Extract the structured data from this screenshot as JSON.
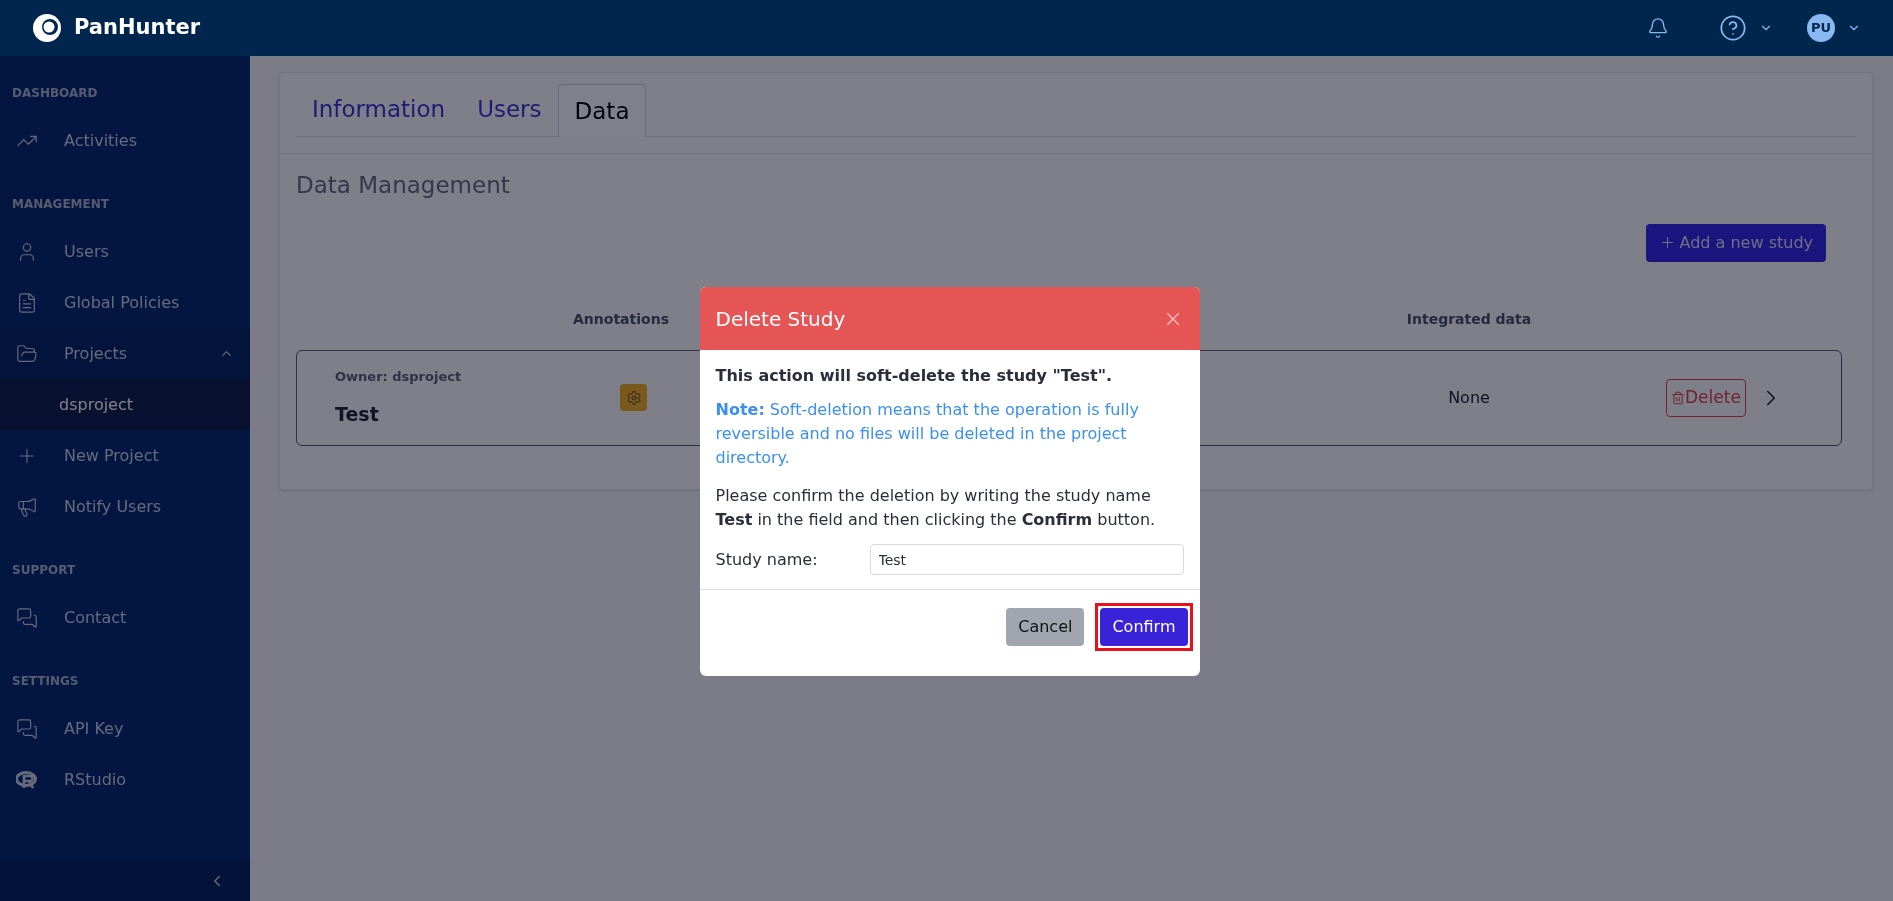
{
  "app": {
    "name": "PanHunter"
  },
  "header": {
    "avatar": "PU"
  },
  "sidebar": {
    "sections": [
      {
        "title": "DASHBOARD",
        "items": [
          {
            "label": "Activities",
            "selected": false
          }
        ]
      },
      {
        "title": "MANAGEMENT",
        "items": [
          {
            "label": "Users",
            "selected": false
          },
          {
            "label": "Global Policies",
            "selected": false
          },
          {
            "label": "Projects",
            "expanded": true,
            "selected": false,
            "children": [
              {
                "label": "dsproject",
                "selected": true
              }
            ]
          },
          {
            "label": "New Project",
            "selected": false
          },
          {
            "label": "Notify Users",
            "selected": false
          }
        ]
      },
      {
        "title": "SUPPORT",
        "items": [
          {
            "label": "Contact",
            "selected": false
          }
        ]
      },
      {
        "title": "SETTINGS",
        "items": [
          {
            "label": "API Key",
            "selected": false
          },
          {
            "label": "RStudio",
            "selected": false
          }
        ]
      }
    ]
  },
  "tabs": [
    {
      "label": "Information",
      "selected": false
    },
    {
      "label": "Users",
      "selected": false
    },
    {
      "label": "Data",
      "selected": true
    }
  ],
  "section_title": "Data Management",
  "add_button": "Add a new study",
  "table": {
    "columns": [
      "Annotations",
      "Integrated data"
    ],
    "rows": [
      {
        "owner": "Owner: dsproject",
        "name": "Test",
        "integrated_data": "None",
        "delete": "Delete"
      }
    ]
  },
  "dialog": {
    "title": "Delete Study",
    "warning": "This action will soft-delete the study \"Test\".",
    "note": "**Note:** Soft-deletion means that the operation is fully reversible and no files will be deleted in the project directory.",
    "instructions": "Please confirm the deletion by writing the study name **Test** in the field and then clicking the **Confirm** button.",
    "field_label": "Study name:",
    "field_value": "Test",
    "buttons": [
      {
        "label": "Cancel",
        "kind": "secondary",
        "highlighted": false
      },
      {
        "label": "Confirm",
        "kind": "primary",
        "highlighted": true
      }
    ]
  }
}
